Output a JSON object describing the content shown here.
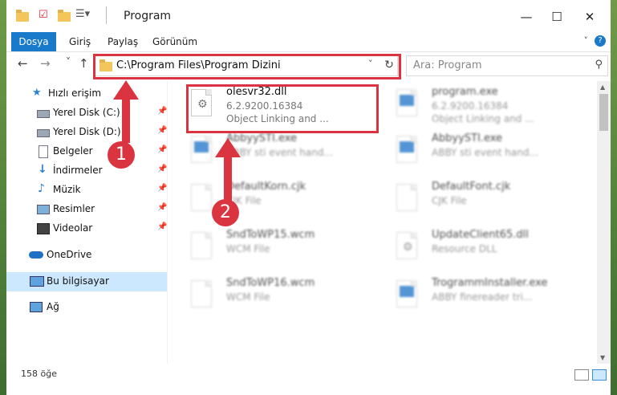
{
  "window": {
    "title": "Program",
    "controls": {
      "minimize": "—",
      "maximize": "☐",
      "close": "✕"
    }
  },
  "ribbon": {
    "tabs": [
      "Dosya",
      "Giriş",
      "Paylaş",
      "Görünüm"
    ],
    "help": "?"
  },
  "navigation": {
    "back": "←",
    "forward": "→",
    "recent": "˅",
    "up": "↑",
    "address": "C:\\Program Files\\Program Dizini",
    "search_placeholder": "Ara: Program"
  },
  "sidebar": {
    "items": [
      {
        "label": "Hızlı erişim",
        "icon": "star-icon",
        "pinned": false
      },
      {
        "label": "Yerel Disk (C:)",
        "icon": "drive-icon",
        "pinned": true
      },
      {
        "label": "Yerel Disk (D:)",
        "icon": "drive-icon",
        "pinned": true
      },
      {
        "label": "Belgeler",
        "icon": "documents-icon",
        "pinned": true
      },
      {
        "label": "İndirmeler",
        "icon": "download-icon",
        "pinned": true
      },
      {
        "label": "Müzik",
        "icon": "music-icon",
        "pinned": true
      },
      {
        "label": "Resimler",
        "icon": "pictures-icon",
        "pinned": true
      },
      {
        "label": "Videolar",
        "icon": "video-icon",
        "pinned": true
      },
      {
        "label": "OneDrive",
        "icon": "cloud-icon",
        "pinned": false
      },
      {
        "label": "Bu bilgisayar",
        "icon": "computer-icon",
        "pinned": false,
        "selected": true
      },
      {
        "label": "Ağ",
        "icon": "network-icon",
        "pinned": false
      }
    ]
  },
  "files": [
    {
      "name": "olesvr32.dll",
      "line2": "6.2.9200.16384",
      "line3": "Object Linking and ...",
      "icon": "dll-gear-icon",
      "highlighted": true
    },
    {
      "name": "program.exe",
      "line2": "6.2.9200.16384",
      "line3": "Object Linking and ...",
      "icon": "exe-icon"
    },
    {
      "name": "AbbyySTI.exe",
      "line2": "ABBY sti event hand...",
      "line3": "",
      "icon": "exe-icon"
    },
    {
      "name": "AbbyySTI.exe",
      "line2": "ABBY sti event hand...",
      "line3": "",
      "icon": "exe-icon"
    },
    {
      "name": "DefaultKorn.cjk",
      "line2": "CJK File",
      "line3": "",
      "icon": "file-icon"
    },
    {
      "name": "DefaultFont.cjk",
      "line2": "CJK File",
      "line3": "",
      "icon": "file-icon"
    },
    {
      "name": "SndToWP15.wcm",
      "line2": "WCM File",
      "line3": "",
      "icon": "file-icon"
    },
    {
      "name": "UpdateClient65.dll",
      "line2": "Resource DLL",
      "line3": "",
      "icon": "dll-gear-icon"
    },
    {
      "name": "SndToWP16.wcm",
      "line2": "WCM File",
      "line3": "",
      "icon": "file-icon"
    },
    {
      "name": "TrogrammInstaller.exe",
      "line2": "ABBY finereader tri...",
      "line3": "",
      "icon": "exe-icon"
    }
  ],
  "status": {
    "count": "158 öğe"
  },
  "annotations": {
    "marker1": "1",
    "marker2": "2"
  },
  "colors": {
    "accent": "#1979ca",
    "highlight": "#d9343f",
    "selection": "#cce8ff"
  }
}
